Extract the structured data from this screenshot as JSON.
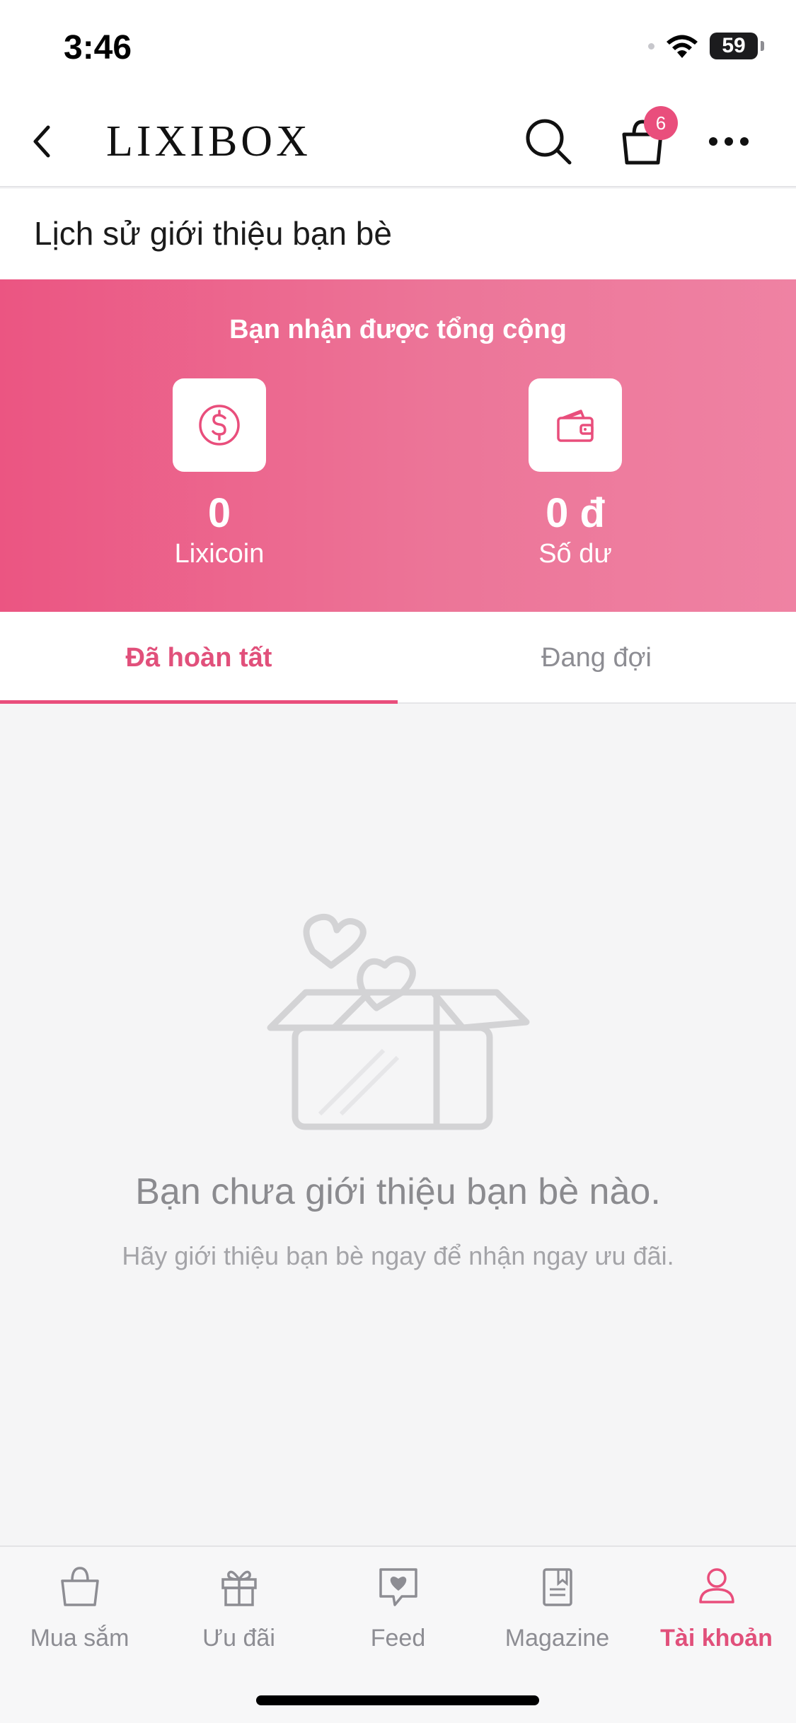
{
  "status_bar": {
    "time": "3:46",
    "battery": "59"
  },
  "nav": {
    "brand": "LIXIBOX",
    "cart_count": "6"
  },
  "page": {
    "title": "Lịch sử giới thiệu bạn bè"
  },
  "summary": {
    "title": "Bạn nhận được tổng cộng",
    "lixicoin_value": "0",
    "lixicoin_label": "Lixicoin",
    "balance_value": "0 đ",
    "balance_label": "Số dư"
  },
  "tabs": [
    {
      "label": "Đã hoàn tất",
      "active": true
    },
    {
      "label": "Đang đợi",
      "active": false
    }
  ],
  "empty_state": {
    "title": "Bạn chưa giới thiệu bạn bè nào.",
    "subtitle": "Hãy giới thiệu bạn bè ngay để nhận ngay ưu đãi."
  },
  "tab_bar": [
    {
      "label": "Mua sắm",
      "icon": "shopping-bag-icon"
    },
    {
      "label": "Ưu đãi",
      "icon": "gift-icon"
    },
    {
      "label": "Feed",
      "icon": "feed-heart-bubble-icon"
    },
    {
      "label": "Magazine",
      "icon": "magazine-icon"
    },
    {
      "label": "Tài khoản",
      "icon": "account-person-icon",
      "active": true
    }
  ],
  "colors": {
    "accent": "#e94e7c",
    "summary_start": "#eb5582",
    "summary_end": "#ef82a3"
  }
}
